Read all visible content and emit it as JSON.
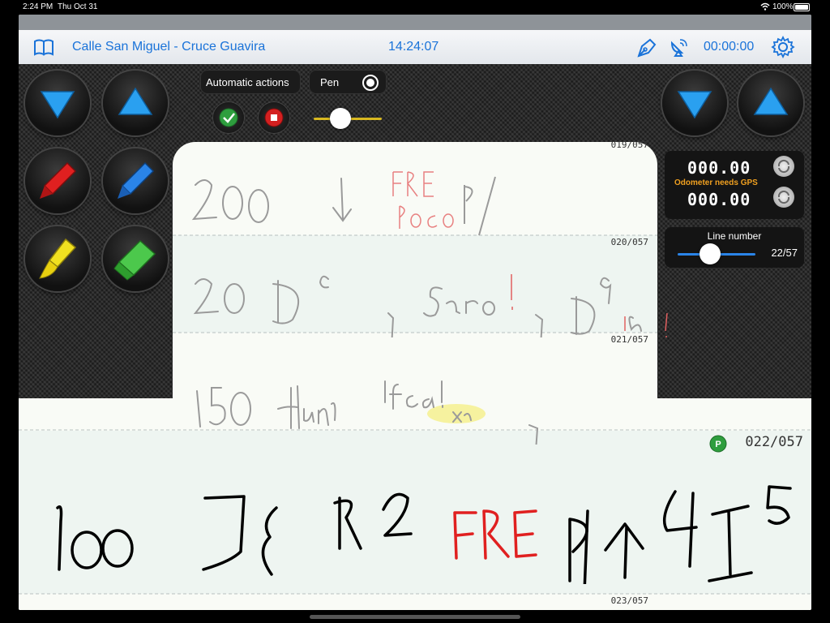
{
  "status_bar": {
    "time": "2:24 PM",
    "date": "Thu Oct 31",
    "battery": "100%"
  },
  "header": {
    "route_title": "Calle San Miguel - Cruce Guavira",
    "clock": "14:24:07",
    "timer": "00:00:00",
    "icons": [
      "book-icon",
      "pen-nib-icon",
      "satellite-dish-icon",
      "gear-icon"
    ]
  },
  "controls": {
    "automatic_actions_label": "Automatic actions",
    "pen_label": "Pen",
    "pen_toggle_on": true,
    "pen_width": 0.35
  },
  "odometer": {
    "value1": "000.00",
    "value2": "000.00",
    "warning": "Odometer needs GPS"
  },
  "line_number": {
    "label": "Line number",
    "value": "22/57",
    "position": 0.39
  },
  "lines": {
    "l19": "019/057",
    "l20": "020/057",
    "l21": "021/057",
    "l22": "022/057",
    "l23": "023/057"
  },
  "colors": {
    "accent": "#1a73d9",
    "odometer_warning": "#f0a020",
    "arrow": "#2aa0f0",
    "check": "#2e9e3e",
    "stop": "#d42020"
  }
}
